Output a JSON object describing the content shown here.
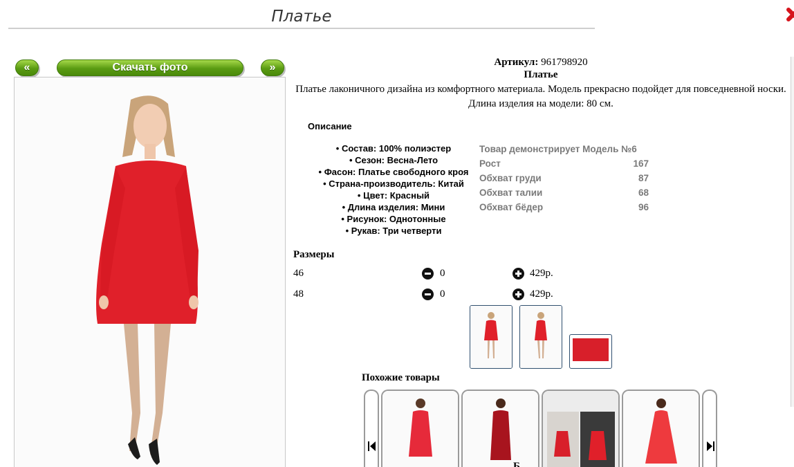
{
  "header": {
    "title": "Платье"
  },
  "nav": {
    "prev_label": "«",
    "download_label": "Скачать фото",
    "next_label": "»"
  },
  "product": {
    "sku_label": "Артикул:",
    "sku_value": "961798920",
    "name": "Платье",
    "description": "Платье лаконичного дизайна из комфортного материала. Модель прекрасно подойдет для повседневной носки. Длина изделия на модели: 80 см."
  },
  "description_section": {
    "heading": "Описание"
  },
  "properties": [
    "• Состав: 100% полиэстер",
    "• Сезон: Весна-Лето",
    "• Фасон: Платье свободного кроя",
    "• Страна-производитель: Китай",
    "• Цвет: Красный",
    "• Длина изделия: Мини",
    "• Рисунок: Однотонные",
    "• Рукав: Три четверти"
  ],
  "model": {
    "heading": "Товар демонстрирует Модель №6",
    "rows": [
      {
        "label": "Рост",
        "value": "167"
      },
      {
        "label": "Обхват груди",
        "value": "87"
      },
      {
        "label": "Обхват талии",
        "value": "68"
      },
      {
        "label": "Обхват бёдер",
        "value": "96"
      }
    ]
  },
  "sizes": {
    "heading": "Размеры",
    "rows": [
      {
        "size": "46",
        "qty": "0",
        "price": "429р."
      },
      {
        "size": "48",
        "qty": "0",
        "price": "429р."
      }
    ]
  },
  "similar": {
    "heading": "Похожие товары"
  },
  "footer_partial": "Б",
  "colors": {
    "accent_green": "#5a9b12",
    "dress_red": "#e0202a",
    "close_red": "#d6141c"
  }
}
